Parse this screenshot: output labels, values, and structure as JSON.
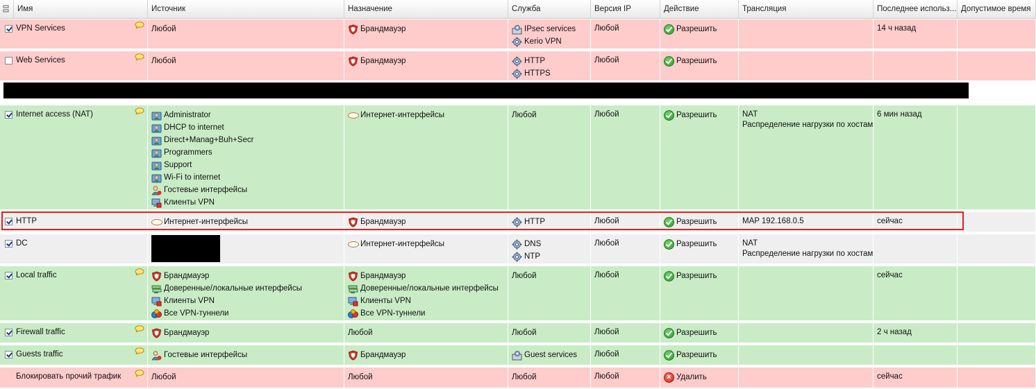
{
  "columns": {
    "name": "Имя",
    "source": "Источник",
    "destination": "Назначение",
    "service": "Служба",
    "ip_version": "Версия IP",
    "action": "Действие",
    "translation": "Трансляция",
    "last_used": "Последнее использ...",
    "valid_time": "Допустимое время"
  },
  "colors": {
    "red_row": "#ffcccc",
    "green_row": "#c9ecc6",
    "grey_row": "#efefef",
    "highlight": "#e0201c"
  },
  "rows": [
    {
      "name": "VPN Services",
      "checked": true,
      "comment": true,
      "color": "red",
      "source": [
        {
          "icon": "none",
          "text": "Любой"
        }
      ],
      "destination": [
        {
          "icon": "shield-icon",
          "text": "Брандмауэр"
        }
      ],
      "service": [
        {
          "icon": "service-group-icon",
          "text": "IPsec services"
        },
        {
          "icon": "gear-icon",
          "text": "Kerio VPN"
        }
      ],
      "ip_version": "Любой",
      "action": {
        "icon": "allow-icon",
        "text": "Разрешить"
      },
      "translation": [],
      "last_used": "14 ч назад"
    },
    {
      "name": "Web Services",
      "checked": false,
      "comment": true,
      "color": "red",
      "source": [
        {
          "icon": "none",
          "text": "Любой"
        }
      ],
      "destination": [
        {
          "icon": "shield-icon",
          "text": "Брандмауэр"
        }
      ],
      "service": [
        {
          "icon": "gear-icon",
          "text": "HTTP"
        },
        {
          "icon": "gear-icon",
          "text": "HTTPS"
        }
      ],
      "ip_version": "Любой",
      "action": {
        "icon": "allow-icon",
        "text": "Разрешить"
      },
      "translation": [],
      "last_used": ""
    },
    {
      "name": "Internet access (NAT)",
      "checked": true,
      "comment": true,
      "color": "green",
      "source": [
        {
          "icon": "user-group-icon",
          "text": "Administrator"
        },
        {
          "icon": "user-group-icon",
          "text": "DHCP to internet"
        },
        {
          "icon": "user-group-icon",
          "text": "Direct+Manag+Buh+Secr"
        },
        {
          "icon": "user-group-icon",
          "text": "Programmers"
        },
        {
          "icon": "user-group-icon",
          "text": "Support"
        },
        {
          "icon": "user-group-icon",
          "text": "Wi-Fi to internet"
        },
        {
          "icon": "guest-icon",
          "text": "Гостевые интерфейсы"
        },
        {
          "icon": "vpn-clients-icon",
          "text": "Клиенты VPN"
        }
      ],
      "destination": [
        {
          "icon": "internet-icon",
          "text": "Интернет-интерфейсы"
        }
      ],
      "service": [
        {
          "icon": "none",
          "text": "Любой"
        }
      ],
      "ip_version": "Любой",
      "action": {
        "icon": "allow-icon",
        "text": "Разрешить"
      },
      "translation": [
        "NAT",
        "Распределение нагрузки по хостам"
      ],
      "last_used": "6 мин назад"
    },
    {
      "name": "HTTP",
      "checked": true,
      "comment": false,
      "color": "grey",
      "source": [
        {
          "icon": "internet-icon",
          "text": "Интернет-интерфейсы"
        }
      ],
      "destination": [
        {
          "icon": "shield-icon",
          "text": "Брандмауэр"
        }
      ],
      "service": [
        {
          "icon": "gear-icon",
          "text": "HTTP"
        }
      ],
      "ip_version": "Любой",
      "action": {
        "icon": "allow-icon",
        "text": "Разрешить"
      },
      "translation": [
        "MAP 192.168.0.5"
      ],
      "last_used": "сейчас"
    },
    {
      "name": "DC",
      "checked": true,
      "comment": false,
      "color": "grey",
      "source": [],
      "destination": [
        {
          "icon": "internet-icon",
          "text": "Интернет-интерфейсы"
        }
      ],
      "service": [
        {
          "icon": "gear-icon",
          "text": "DNS"
        },
        {
          "icon": "gear-icon",
          "text": "NTP"
        }
      ],
      "ip_version": "Любой",
      "action": {
        "icon": "allow-icon",
        "text": "Разрешить"
      },
      "translation": [
        "NAT",
        "Распределение нагрузки по хостам"
      ],
      "last_used": ""
    },
    {
      "name": "Local traffic",
      "checked": true,
      "comment": true,
      "color": "green",
      "source": [
        {
          "icon": "shield-icon",
          "text": "Брандмауэр"
        },
        {
          "icon": "trusted-interfaces-icon",
          "text": "Доверенные/локальные интерфейсы"
        },
        {
          "icon": "vpn-clients-icon",
          "text": "Клиенты VPN"
        },
        {
          "icon": "vpn-tunnels-icon",
          "text": "Все VPN-туннели"
        }
      ],
      "destination": [
        {
          "icon": "shield-icon",
          "text": "Брандмауэр"
        },
        {
          "icon": "trusted-interfaces-icon",
          "text": "Доверенные/локальные интерфейсы"
        },
        {
          "icon": "vpn-clients-icon",
          "text": "Клиенты VPN"
        },
        {
          "icon": "vpn-tunnels-icon",
          "text": "Все VPN-туннели"
        }
      ],
      "service": [
        {
          "icon": "none",
          "text": "Любой"
        }
      ],
      "ip_version": "Любой",
      "action": {
        "icon": "allow-icon",
        "text": "Разрешить"
      },
      "translation": [],
      "last_used": "сейчас"
    },
    {
      "name": "Firewall traffic",
      "checked": true,
      "comment": true,
      "color": "green",
      "source": [
        {
          "icon": "shield-icon",
          "text": "Брандмауэр"
        }
      ],
      "destination": [
        {
          "icon": "none",
          "text": "Любой"
        }
      ],
      "service": [
        {
          "icon": "none",
          "text": "Любой"
        }
      ],
      "ip_version": "Любой",
      "action": {
        "icon": "allow-icon",
        "text": "Разрешить"
      },
      "translation": [],
      "last_used": "2 ч назад"
    },
    {
      "name": "Guests traffic",
      "checked": true,
      "comment": true,
      "color": "green",
      "source": [
        {
          "icon": "guest-icon",
          "text": "Гостевые интерфейсы"
        }
      ],
      "destination": [
        {
          "icon": "shield-icon",
          "text": "Брандмауэр"
        }
      ],
      "service": [
        {
          "icon": "service-group-icon",
          "text": "Guest services"
        }
      ],
      "ip_version": "Любой",
      "action": {
        "icon": "allow-icon",
        "text": "Разрешить"
      },
      "translation": [],
      "last_used": ""
    },
    {
      "name": "Блокировать прочий трафик",
      "checked": null,
      "comment": true,
      "color": "red",
      "source": [
        {
          "icon": "none",
          "text": "Любой"
        }
      ],
      "destination": [
        {
          "icon": "none",
          "text": "Любой"
        }
      ],
      "service": [
        {
          "icon": "none",
          "text": "Любой"
        }
      ],
      "ip_version": "Любой",
      "action": {
        "icon": "deny-icon",
        "text": "Удалить"
      },
      "translation": [],
      "last_used": "сейчас"
    }
  ]
}
